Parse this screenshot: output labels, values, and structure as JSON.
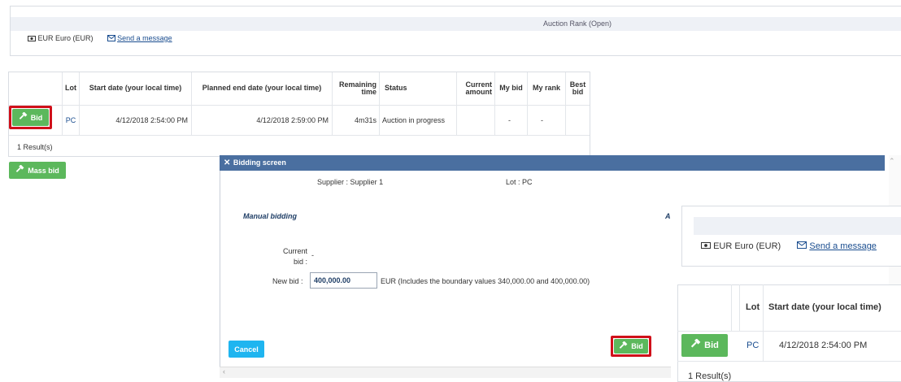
{
  "auction": {
    "rank_title": "Auction Rank (Open)",
    "currency": "EUR Euro (EUR)",
    "send_message": "Send a message"
  },
  "table": {
    "headers": {
      "lot": "Lot",
      "start_date": "Start date (your local time)",
      "planned_end": "Planned end date (your local time)",
      "remaining_1": "Remaining",
      "remaining_2": "time",
      "status": "Status",
      "current_1": "Current",
      "current_2": "amount",
      "my_bid": "My bid",
      "my_rank": "My rank",
      "best_1": "Best",
      "best_2": "bid"
    },
    "row": {
      "bid_label": "Bid",
      "lot": "PC",
      "start_date": "4/12/2018 2:54:00 PM",
      "end_date": "4/12/2018 2:59:00 PM",
      "remaining": "4m31s",
      "status": "Auction in progress",
      "current_amount": "",
      "my_bid": "-",
      "my_rank": "-",
      "best_bid": ""
    },
    "results": "1 Result(s)",
    "mass_bid": "Mass bid"
  },
  "dialog": {
    "title": "Bidding screen",
    "supplier_label": "Supplier :",
    "supplier_value": "Supplier 1",
    "lot_label": "Lot :",
    "lot_value": "PC",
    "section": "Manual bidding",
    "section_right": "A",
    "current_bid_label_1": "Current",
    "current_bid_label_2": "bid :",
    "current_bid_value": "-",
    "new_bid_label": "New bid :",
    "new_bid_value": "400,000.00",
    "new_bid_hint": "EUR  (Includes the boundary values 340,000.00  and 400,000.00)",
    "cancel": "Cancel",
    "bid": "Bid"
  },
  "right_panel": {
    "currency": "EUR Euro (EUR)",
    "send_message": "Send a message",
    "lot_header": "Lot",
    "start_header": "Start date (your local time)",
    "bid_label": "Bid",
    "lot": "PC",
    "start_date": "4/12/2018 2:54:00 PM",
    "results": "1 Result(s)"
  },
  "colors": {
    "green": "#5cb85c",
    "dialog_header": "#4a6fa0",
    "cancel_blue": "#1fb5f0",
    "highlight_red": "#d0101a"
  }
}
